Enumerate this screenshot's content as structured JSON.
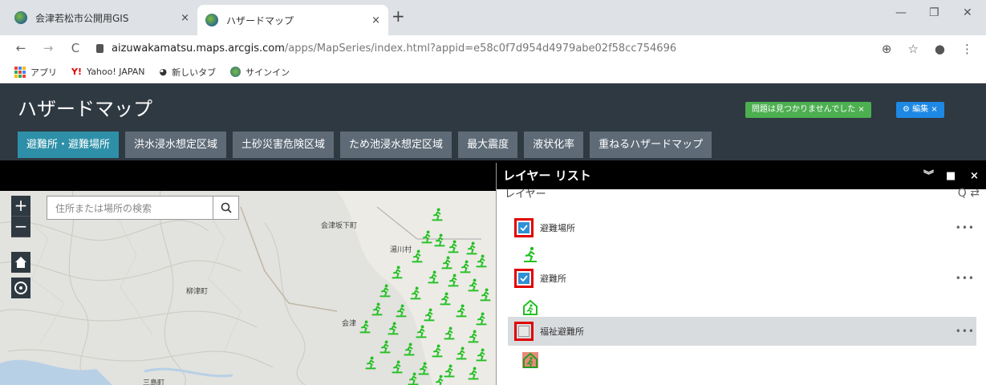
{
  "browser": {
    "tabs": [
      {
        "title": "会津若松市公開用GIS",
        "close": "×"
      },
      {
        "title": "ハザードマップ",
        "close": "×"
      }
    ],
    "new_tab": "+",
    "window_controls": {
      "minimize": "—",
      "restore": "❐",
      "close": "✕"
    },
    "url_host": "aizuwakamatsu.maps.arcgis.com",
    "url_path": "/apps/MapSeries/index.html?appid=e58c0f7d954d4979abe02f58cc754696",
    "bookmarks": [
      "アプリ",
      "Yahoo! JAPAN",
      "新しいタブ",
      "サインイン"
    ],
    "icons": [
      "back-icon",
      "forward-icon",
      "reload-icon",
      "lock-icon",
      "translate-icon",
      "star-icon",
      "account-icon",
      "kebab-menu-icon"
    ]
  },
  "app": {
    "title": "ハザードマップ",
    "status_badge": "問題は見つかりませんでした ×",
    "edit_badge": "⚙ 編集 ×",
    "tabs": [
      "避難所・避難場所",
      "洪水浸水想定区域",
      "土砂災害危険区域",
      "ため池浸水想定区域",
      "最大震度",
      "液状化率",
      "重ねるハザードマップ"
    ],
    "active_tab": "避難所・避難場所"
  },
  "map": {
    "zoom_in": "+",
    "zoom_out": "−",
    "search_placeholder": "住所または場所の検索",
    "labels": [
      "会津坂下町",
      "湯川村",
      "柳津町",
      "三島町",
      "会津"
    ]
  },
  "layer_panel": {
    "title": "レイヤー リスト",
    "controls": [
      "︾",
      "■",
      "×"
    ],
    "subtitle": "レイヤー",
    "sub_icons": "Q ⇄",
    "more": "•••",
    "layers": [
      {
        "name": "避難場所",
        "checked": true
      },
      {
        "name": "避難所",
        "checked": true
      },
      {
        "name": "福祉避難所",
        "checked": false
      }
    ]
  },
  "colors": {
    "accent_tab": "#2e90a8",
    "symbol_green": "#22c022",
    "highlight_red": "#e00000"
  }
}
